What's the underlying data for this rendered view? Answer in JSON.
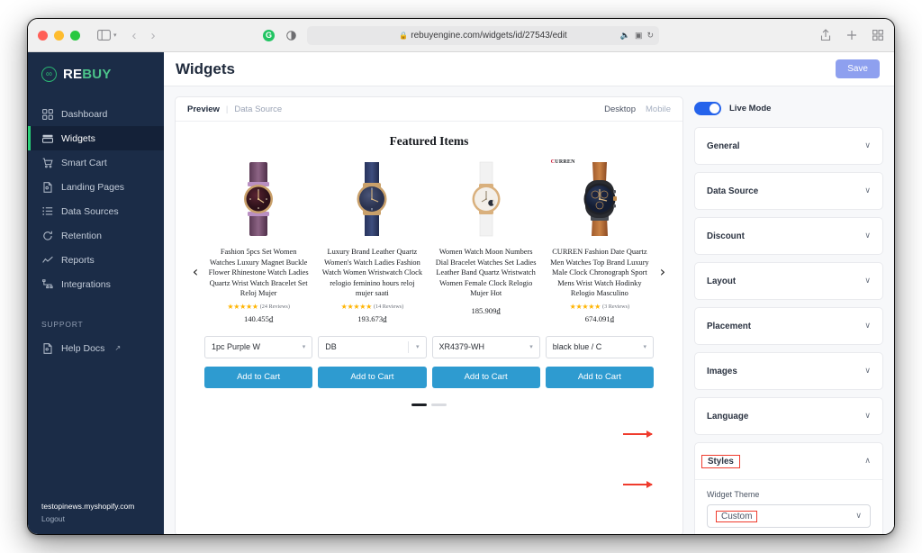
{
  "browser": {
    "url": "rebuyengine.com/widgets/id/27543/edit",
    "lock_icon": "lock-icon",
    "back_icon": "back-arrow-icon",
    "forward_icon": "forward-arrow-icon",
    "sidebar_icon": "sidebar-toggle-icon",
    "extension_icon": "extension-shield-icon",
    "reader_icon": "reader-mode-icon",
    "audio_icon": "audio-mute-icon",
    "translate_icon": "translate-icon",
    "reload_icon": "reload-icon",
    "share_icon": "share-icon",
    "newtab_icon": "plus-icon",
    "tabs_icon": "tab-overview-icon"
  },
  "sidebar": {
    "logo": {
      "mark": "infinity-icon",
      "part1": "RE",
      "part2": "BUY"
    },
    "items": [
      {
        "label": "Dashboard",
        "icon": "grid-icon",
        "active": false
      },
      {
        "label": "Widgets",
        "icon": "widgets-icon",
        "active": true
      },
      {
        "label": "Smart Cart",
        "icon": "cart-icon",
        "active": false
      },
      {
        "label": "Landing Pages",
        "icon": "page-icon",
        "active": false
      },
      {
        "label": "Data Sources",
        "icon": "list-icon",
        "active": false
      },
      {
        "label": "Retention",
        "icon": "refresh-icon",
        "active": false
      },
      {
        "label": "Reports",
        "icon": "chart-line-icon",
        "active": false
      },
      {
        "label": "Integrations",
        "icon": "nodes-icon",
        "active": false
      }
    ],
    "section_label": "SUPPORT",
    "support_items": [
      {
        "label": "Help Docs",
        "icon": "doc-icon",
        "external": "↗"
      }
    ],
    "footer": {
      "shop": "testopinews.myshopify.com",
      "logout": "Logout"
    }
  },
  "header": {
    "title": "Widgets",
    "save_label": "Save"
  },
  "preview": {
    "tab_preview": "Preview",
    "separator": "|",
    "tab_data_source": "Data Source",
    "view_desktop": "Desktop",
    "view_mobile": "Mobile",
    "widget_title": "Featured Items",
    "prev_arrow": "‹",
    "next_arrow": "›",
    "products": [
      {
        "title": "Fashion 5pcs Set Women Watches Luxury Magnet Buckle Flower Rhinestone Watch Ladies Quartz Wrist Watch Bracelet Set Reloj Mujer",
        "stars": "★★★★★",
        "reviews": "(24 Reviews)",
        "price": "140.455₫",
        "variant": "1pc Purple W",
        "cart_label": "Add to Cart",
        "badge": ""
      },
      {
        "title": "Luxury Brand Leather Quartz Women's Watch Ladies Fashion Watch Women Wristwatch Clock relogio feminino hours reloj mujer saati",
        "stars": "★★★★★",
        "reviews": "(14 Reviews)",
        "price": "193.673₫",
        "variant": "DB",
        "cart_label": "Add to Cart",
        "badge": ""
      },
      {
        "title": "Women Watch Moon Numbers Dial Bracelet Watches Set Ladies Leather Band Quartz Wristwatch Women Female Clock Relogio Mujer Hot",
        "stars": "",
        "reviews": "",
        "price": "185.909₫",
        "variant": "XR4379-WH",
        "cart_label": "Add to Cart",
        "badge": ""
      },
      {
        "title": "CURREN Fashion Date Quartz Men Watches Top Brand Luxury Male Clock Chronograph Sport Mens Wrist Watch Hodinky Relogio Masculino",
        "stars": "★★★★★",
        "reviews": "(3 Reviews)",
        "price": "674.091₫",
        "variant": "black blue / C",
        "cart_label": "Add to Cart",
        "badge": "CURREN"
      }
    ]
  },
  "settings": {
    "live_mode_label": "Live Mode",
    "sections": [
      {
        "label": "General",
        "expanded": false
      },
      {
        "label": "Data Source",
        "expanded": false
      },
      {
        "label": "Discount",
        "expanded": false
      },
      {
        "label": "Layout",
        "expanded": false
      },
      {
        "label": "Placement",
        "expanded": false
      },
      {
        "label": "Images",
        "expanded": false
      },
      {
        "label": "Language",
        "expanded": false
      },
      {
        "label": "Styles",
        "expanded": true
      }
    ],
    "styles": {
      "field_label": "Widget Theme",
      "theme_value": "Custom"
    },
    "caret_down": "∨",
    "caret_up": "∧"
  },
  "colors": {
    "sidebar_bg": "#1b2c47",
    "accent_green": "#2bd07a",
    "cart_blue": "#2e9bd0",
    "toggle_blue": "#2563eb",
    "annotation_red": "#ef3b2d",
    "star_gold": "#ffb400",
    "save_btn": "#8ea0ef"
  }
}
